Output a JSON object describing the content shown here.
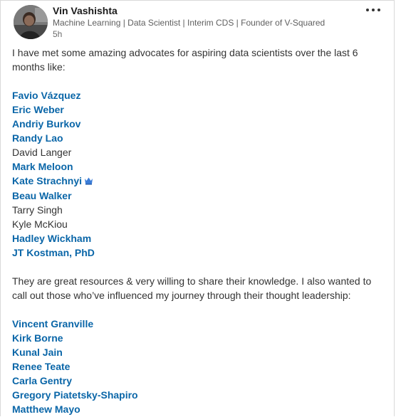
{
  "post": {
    "author": {
      "name": "Vin Vashishta",
      "headline": "Machine Learning | Data Scientist | Interim CDS | Founder of V-Squared",
      "timestamp": "5h"
    },
    "intro": "I have met some amazing advocates for aspiring data scientists over the last 6 months like:",
    "advocates": [
      {
        "text": "Favio Vázquez",
        "mention": true
      },
      {
        "text": "Eric Weber",
        "mention": true
      },
      {
        "text": "Andriy Burkov",
        "mention": true
      },
      {
        "text": "Randy Lao",
        "mention": true
      },
      {
        "text": "David Langer",
        "mention": false
      },
      {
        "text": "Mark Meloon",
        "mention": true
      },
      {
        "text": "Kate Strachnyi",
        "mention": true,
        "emoji": "crown-icon"
      },
      {
        "text": "Beau Walker",
        "mention": true
      },
      {
        "text": "Tarry Singh",
        "mention": false
      },
      {
        "text": "Kyle McKiou",
        "mention": false
      },
      {
        "text": "Hadley Wickham",
        "mention": true
      },
      {
        "text": "JT Kostman, PhD",
        "mention": true
      }
    ],
    "middle": "They are great resources & very willing to share their knowledge. I also wanted to call out those who’ve influenced my journey through their thought leadership:",
    "influencers": [
      {
        "text": "Vincent Granville",
        "mention": true
      },
      {
        "text": "Kirk Borne",
        "mention": true
      },
      {
        "text": "Kunal Jain",
        "mention": true
      },
      {
        "text": "Renee Teate",
        "mention": true
      },
      {
        "text": "Carla Gentry",
        "mention": true
      },
      {
        "text": "Gregory Piatetsky-Shapiro",
        "mention": true
      },
      {
        "text": "Matthew Mayo",
        "mention": true
      }
    ]
  },
  "colors": {
    "mention": "#0a66a8",
    "text": "#333333",
    "meta": "#5f5f5f",
    "border": "#d9d9d9"
  }
}
